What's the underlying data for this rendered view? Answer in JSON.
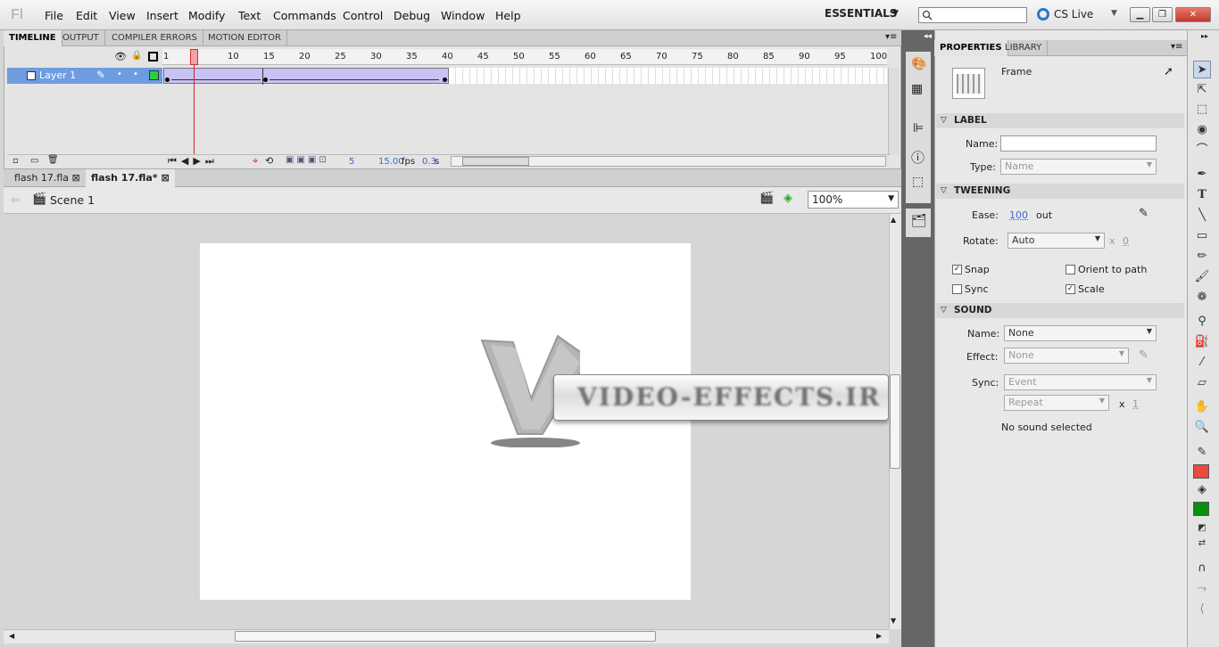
{
  "app": {
    "logo": "Fl",
    "menus": [
      "File",
      "Edit",
      "View",
      "Insert",
      "Modify",
      "Text",
      "Commands",
      "Control",
      "Debug",
      "Window",
      "Help"
    ],
    "workspace": "ESSENTIALS",
    "cslive": "CS Live"
  },
  "timeline": {
    "tabs": [
      "TIMELINE",
      "OUTPUT",
      "COMPILER ERRORS",
      "MOTION EDITOR"
    ],
    "ruler": [
      "1",
      "5",
      "10",
      "15",
      "20",
      "25",
      "30",
      "35",
      "40",
      "45",
      "50",
      "55",
      "60",
      "65",
      "70",
      "75",
      "80",
      "85",
      "90",
      "95",
      "100"
    ],
    "layer": "Layer 1",
    "current_frame": "5",
    "fps": "15.00",
    "fps_unit": "fps",
    "time": "0.3",
    "time_unit": "s"
  },
  "documents": {
    "tabs": [
      "flash 17.fla",
      "flash 17.fla*"
    ],
    "scene": "Scene 1",
    "zoom": "100%"
  },
  "stage": {
    "artwork_text": "VIDEO-EFFECTS.IR"
  },
  "properties": {
    "tabs": [
      "PROPERTIES",
      "LIBRARY"
    ],
    "type": "Frame",
    "label": {
      "header": "LABEL",
      "name_label": "Name:",
      "name_value": "",
      "type_label": "Type:",
      "type_value": "Name"
    },
    "tweening": {
      "header": "TWEENING",
      "ease_label": "Ease:",
      "ease_value": "100",
      "ease_dir": "out",
      "rotate_label": "Rotate:",
      "rotate_value": "Auto",
      "times": "x",
      "rot_count": "0",
      "snap": "Snap",
      "orient": "Orient to path",
      "sync": "Sync",
      "scale": "Scale"
    },
    "sound": {
      "header": "SOUND",
      "name_label": "Name:",
      "name_value": "None",
      "effect_label": "Effect:",
      "effect_value": "None",
      "sync_label": "Sync:",
      "sync_value": "Event",
      "repeat_value": "Repeat",
      "times": "x",
      "repeat_count": "1",
      "status": "No sound selected"
    }
  },
  "colors": {
    "stroke": "#e84c3d",
    "fill": "#0a8f0a"
  }
}
